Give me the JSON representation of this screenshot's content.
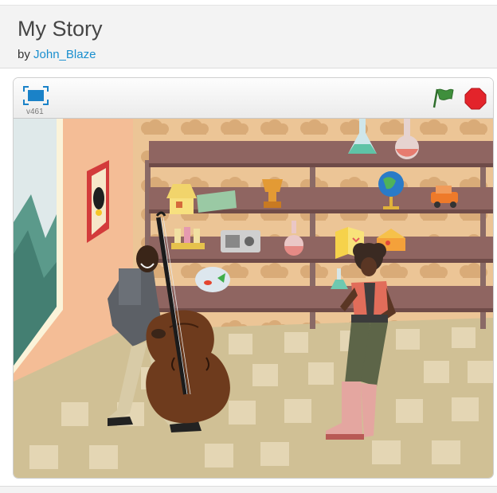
{
  "project": {
    "title": "My Story",
    "by_label": "by",
    "author": "John_Blaze"
  },
  "player": {
    "version": "v461",
    "icons": {
      "fullscreen": "fullscreen-icon",
      "green_flag": "green-flag-icon",
      "stop": "stop-sign-icon"
    },
    "colors": {
      "flag": "#3f8f3c",
      "stop": "#e3242b",
      "fullscreen": "#1a82c8"
    }
  }
}
